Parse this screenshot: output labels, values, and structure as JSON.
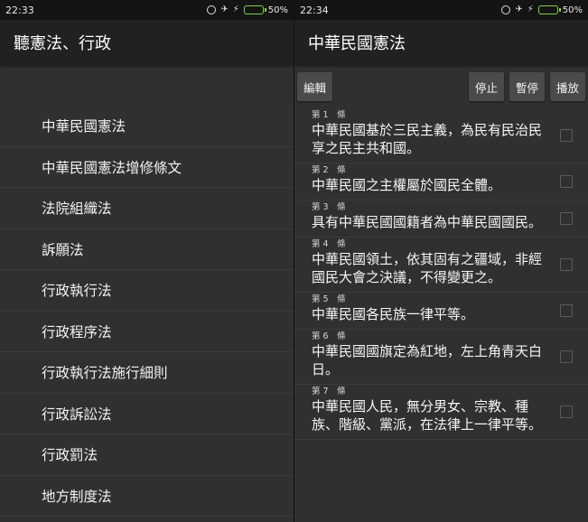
{
  "left": {
    "status": {
      "time": "22:33",
      "battery": "50%"
    },
    "title": "聽憲法、行政",
    "items": [
      "中華民國憲法",
      "中華民國憲法增修條文",
      "法院組織法",
      "訴願法",
      "行政執行法",
      "行政程序法",
      "行政執行法施行細則",
      "行政訴訟法",
      "行政罰法",
      "地方制度法"
    ]
  },
  "right": {
    "status": {
      "time": "22:34",
      "battery": "50%"
    },
    "title": "中華民國憲法",
    "buttons": {
      "edit": "編輯",
      "stop": "停止",
      "pause": "暫停",
      "play": "播放"
    },
    "articles": [
      {
        "num": "第 1　條",
        "text": "中華民國基於三民主義，為民有民治民享之民主共和國。"
      },
      {
        "num": "第 2　條",
        "text": "中華民國之主權屬於國民全體。"
      },
      {
        "num": "第 3　條",
        "text": "具有中華民國國籍者為中華民國國民。"
      },
      {
        "num": "第 4　條",
        "text": "中華民國領土，依其固有之疆域，非經國民大會之決議，不得變更之。"
      },
      {
        "num": "第 5　條",
        "text": "中華民國各民族一律平等。"
      },
      {
        "num": "第 6　條",
        "text": "中華民國國旗定為紅地，左上角青天白日。"
      },
      {
        "num": "第 7　條",
        "text": "中華民國人民，無分男女、宗教、種族、階級、黨派，在法律上一律平等。"
      }
    ]
  },
  "colors": {
    "battery": "#7fd14b",
    "appbar": "#212121",
    "background": "#303030"
  }
}
